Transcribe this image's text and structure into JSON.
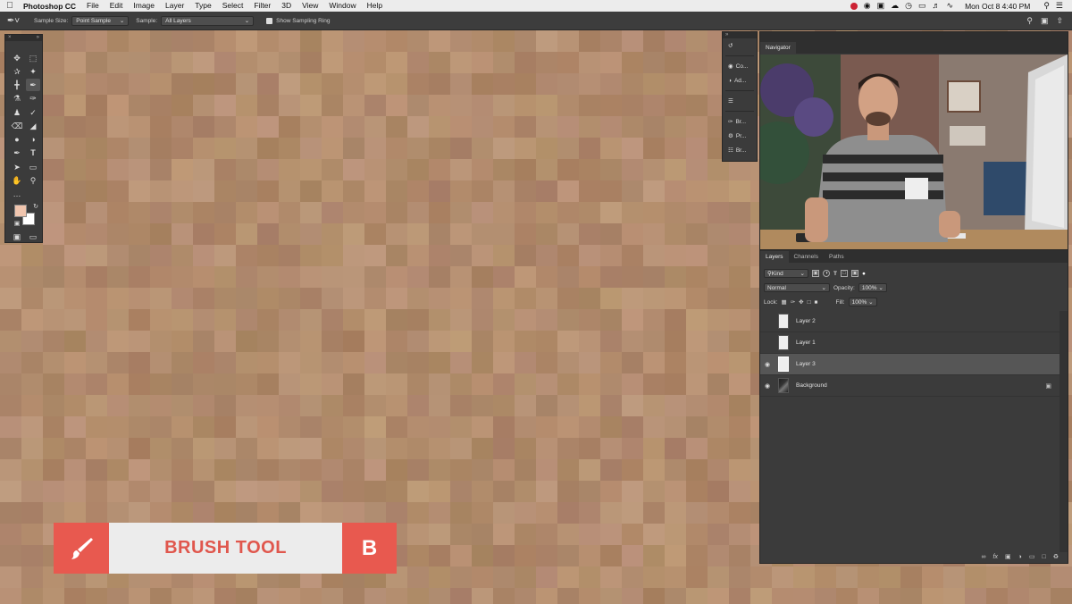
{
  "menubar": {
    "app_name": "Photoshop CC",
    "items": [
      "File",
      "Edit",
      "Image",
      "Layer",
      "Type",
      "Select",
      "Filter",
      "3D",
      "View",
      "Window",
      "Help"
    ],
    "clock": "Mon Oct 8  4:40 PM"
  },
  "options": {
    "sample_size_label": "Sample Size:",
    "sample_size_value": "Point Sample",
    "sample_label": "Sample:",
    "sample_value": "All Layers",
    "sampling_ring_label": "Show Sampling Ring",
    "sampling_ring_checked": true
  },
  "icon_panel": {
    "items": [
      {
        "icon": "history-icon",
        "label": ""
      },
      {
        "icon": "color-icon",
        "label": "Co..."
      },
      {
        "icon": "adjustments-icon",
        "label": "Ad..."
      },
      {
        "icon": "ruler-icon",
        "label": ""
      },
      {
        "icon": "brush-settings-icon",
        "label": "Br..."
      },
      {
        "icon": "properties-icon",
        "label": "Pr..."
      },
      {
        "icon": "brushes-icon",
        "label": "Br..."
      }
    ]
  },
  "navigator": {
    "title": "Navigator"
  },
  "layers": {
    "tabs": [
      "Layers",
      "Channels",
      "Paths"
    ],
    "filter_value": "Kind",
    "blend_mode": "Normal",
    "opacity_label": "Opacity:",
    "opacity_value": "100%",
    "lock_label": "Lock:",
    "fill_label": "Fill:",
    "fill_value": "100%",
    "list": [
      {
        "name": "Layer 2",
        "visible": false,
        "selected": false,
        "locked": false,
        "thumb": "white"
      },
      {
        "name": "Layer 1",
        "visible": false,
        "selected": false,
        "locked": false,
        "thumb": "white"
      },
      {
        "name": "Layer 3",
        "visible": true,
        "selected": true,
        "locked": false,
        "thumb": "white"
      },
      {
        "name": "Background",
        "visible": true,
        "selected": false,
        "locked": true,
        "thumb": "photo"
      }
    ]
  },
  "colors": {
    "foreground": "#f0c5ae",
    "background": "#ffffff",
    "accent": "#e8594f"
  },
  "lower_third": {
    "label": "BRUSH TOOL",
    "shortcut": "B",
    "icon": "brush-icon"
  }
}
